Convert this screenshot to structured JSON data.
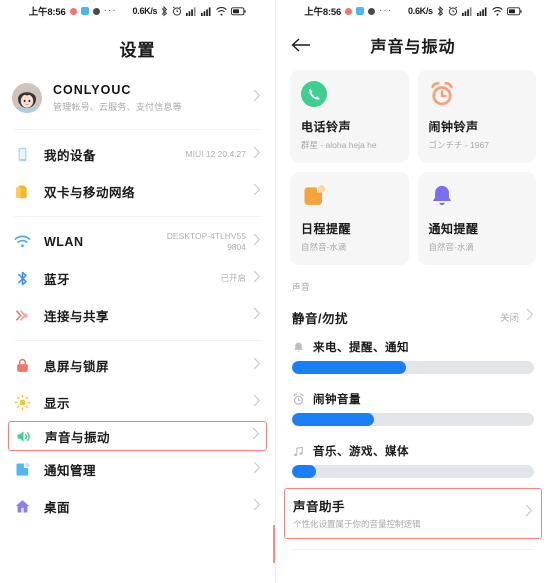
{
  "statusbar": {
    "time": "上午8:56",
    "ellipsis": "···",
    "network_speed": "0.6K/s",
    "icons": [
      "bluetooth-icon",
      "alarm-icon",
      "signal-1-icon",
      "signal-2-icon",
      "wifi-icon",
      "battery-icon"
    ]
  },
  "left": {
    "title": "设置",
    "account": {
      "name": "CONLYOUC",
      "subtitle": "管理帐号、云服务、支付信息等"
    },
    "items": [
      {
        "label": "我的设备",
        "value": "MIUI 12 20.4.27",
        "icon": "device-icon",
        "color": "#a9d4f5",
        "highlight": false
      },
      {
        "label": "双卡与移动网络",
        "value": "",
        "icon": "sim-card-icon",
        "color": "#fbc13c",
        "highlight": false
      },
      {
        "label": "WLAN",
        "value": "DESKTOP-4TLHV55\n9804",
        "icon": "wifi-icon",
        "color": "#55a9f0",
        "highlight": false
      },
      {
        "label": "蓝牙",
        "value": "已开启",
        "icon": "bluetooth-icon",
        "color": "#3d93f5",
        "highlight": false
      },
      {
        "label": "连接与共享",
        "value": "",
        "icon": "share-icon",
        "color": "#f4736a",
        "highlight": false
      },
      {
        "label": "息屏与锁屏",
        "value": "",
        "icon": "lock-icon",
        "color": "#f4736a",
        "highlight": false
      },
      {
        "label": "显示",
        "value": "",
        "icon": "brightness-icon",
        "color": "#fbc13c",
        "highlight": false
      },
      {
        "label": "声音与振动",
        "value": "",
        "icon": "volume-icon",
        "color": "#3ecf8e",
        "highlight": true
      },
      {
        "label": "通知管理",
        "value": "",
        "icon": "notification-icon",
        "color": "#53b7f0",
        "highlight": false
      },
      {
        "label": "桌面",
        "value": "",
        "icon": "home-icon",
        "color": "#8b7ef0",
        "highlight": false
      }
    ],
    "highlight_color": "#f5817d"
  },
  "right": {
    "title": "声音与振动",
    "back_icon": "back-arrow-icon",
    "cards": [
      {
        "title": "电话铃声",
        "subtitle": "群星 - aloha heja he",
        "icon": "phone-icon",
        "color": "#3ecf8e"
      },
      {
        "title": "闹钟铃声",
        "subtitle": "ゴンチチ - 1967",
        "icon": "alarm-clock-icon",
        "color": "#f9a07a"
      },
      {
        "title": "日程提醒",
        "subtitle": "自然音-水滴",
        "icon": "calendar-icon",
        "color": "#f5a33c"
      },
      {
        "title": "通知提醒",
        "subtitle": "自然音-水滴",
        "icon": "bell-icon",
        "color": "#7b6ef0"
      }
    ],
    "section_label": "声音",
    "dnd_row": {
      "label": "静音/勿扰",
      "value": "关闭"
    },
    "sliders": [
      {
        "label": "来电、提醒、通知",
        "icon": "bell-small-icon",
        "percent": 47
      },
      {
        "label": "闹钟音量",
        "icon": "alarm-small-icon",
        "percent": 34
      },
      {
        "label": "音乐、游戏、媒体",
        "icon": "music-note-icon",
        "percent": 10
      }
    ],
    "assistant": {
      "title": "声音助手",
      "subtitle": "个性化设置属于你的音量控制逻辑"
    },
    "slider_fill_color": "#1a7ef5",
    "slider_track_color": "#e2e5e9",
    "highlight_color": "#f5817d"
  }
}
